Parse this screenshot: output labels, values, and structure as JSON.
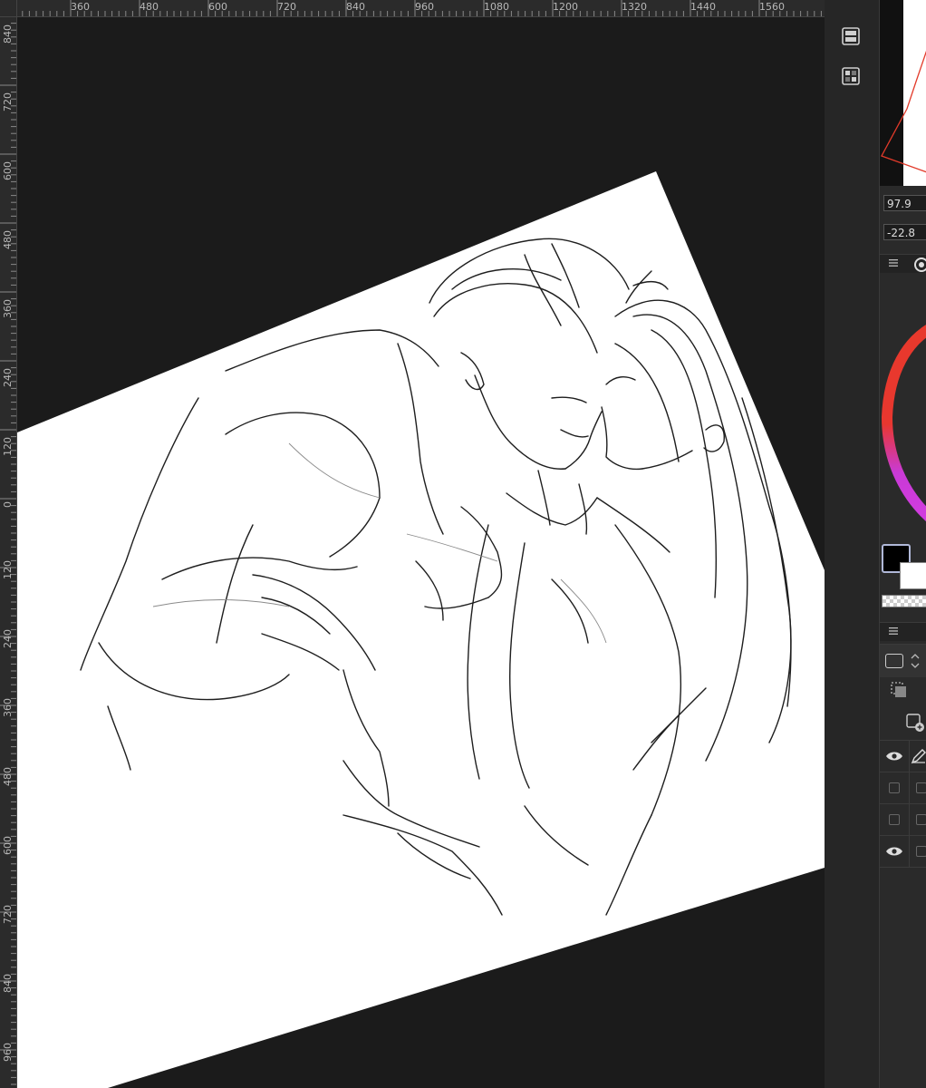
{
  "ruler_top_ticks": [
    "360",
    "480",
    "600",
    "720",
    "840",
    "960",
    "1080",
    "1200",
    "1320",
    "1440",
    "1560"
  ],
  "ruler_left_ticks": [
    "840",
    "720",
    "600",
    "480",
    "360",
    "240",
    "120",
    "0",
    "120",
    "240",
    "360",
    "480",
    "600",
    "720",
    "840",
    "960"
  ],
  "navigator": {
    "angle_value": "97.9",
    "rotation_value": "-22.8"
  },
  "colors": {
    "main": "#000000",
    "sub": "#ffffff",
    "accent": "#b0b8d8",
    "wheel_red": "#e8392c",
    "wheel_magenta": "#d23ce0"
  },
  "icons": {
    "timeline": "film-strip-icon",
    "material": "grid-panel-icon",
    "menu": "hamburger-icon",
    "layer_visible": "eye-icon",
    "pen": "pen-icon"
  },
  "layers": [
    {
      "visible": true,
      "kind": "pen"
    },
    {
      "visible": false,
      "kind": "box"
    },
    {
      "visible": false,
      "kind": "box"
    },
    {
      "visible": true,
      "kind": "box"
    }
  ]
}
